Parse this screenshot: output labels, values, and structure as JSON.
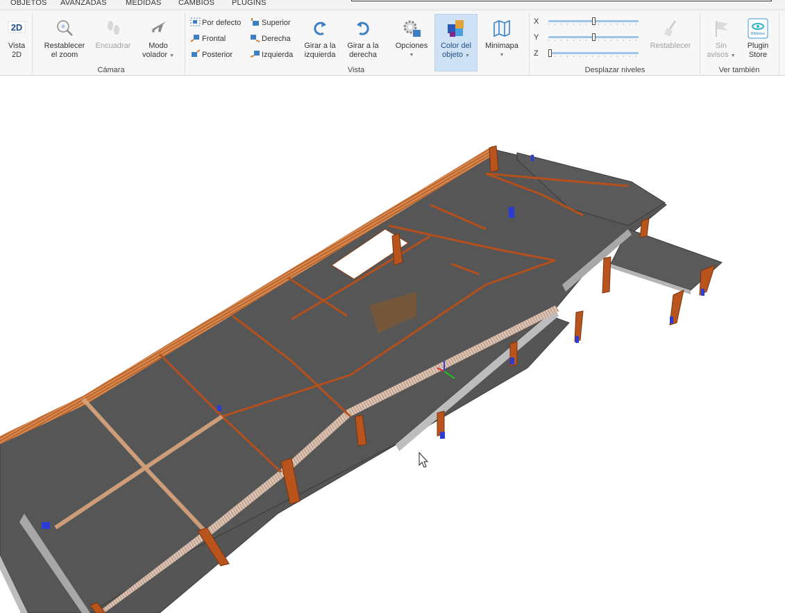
{
  "tabs": [
    "OBJETOS",
    "AVANZADAS",
    "MEDIDAS",
    "CAMBIOS",
    "PLUGINS"
  ],
  "ribbon": {
    "vista2d": {
      "badge": "2D",
      "line1": "Vista",
      "line2": "2D"
    },
    "camara": {
      "group_label": "Cámara",
      "reset_zoom": {
        "line1": "Restablecer",
        "line2": "el zoom"
      },
      "fit": {
        "line1": "Encuadrar"
      },
      "fly": {
        "line1": "Modo",
        "line2": "volador"
      }
    },
    "vista": {
      "group_label": "Vista",
      "default": "Por defecto",
      "front": "Frontal",
      "back": "Posterior",
      "top": "Superior",
      "right": "Derecha",
      "left": "Izquierda",
      "rot_left": {
        "line1": "Girar a la",
        "line2": "izquierda"
      },
      "rot_right": {
        "line1": "Girar a la",
        "line2": "derecha"
      },
      "options": {
        "line1": "Opciones"
      },
      "object_color": {
        "line1": "Color del",
        "line2": "objeto"
      },
      "minimap": {
        "line1": "Minimapa"
      }
    },
    "levels": {
      "group_label": "Desplazar niveles",
      "x_label": "X",
      "y_label": "Y",
      "z_label": "Z",
      "x_value": 0.5,
      "y_value": 0.5,
      "z_value": 0.0,
      "reset": "Restablecer"
    },
    "see_also": {
      "group_label": "Ver también",
      "warnings": {
        "line1": "Sin",
        "line2": "avisos"
      },
      "plugin_store": {
        "line1": "Plugin",
        "line2": "Store",
        "logo_text": "BIMstore"
      }
    }
  },
  "colors": {
    "slab": "#4f4f4f",
    "slab_edge": "#b9b9b9",
    "beam": "#c05a1e",
    "column": "#b8541c",
    "rebar_blue": "#2a3bd6",
    "accent": "#3c7fc4"
  }
}
